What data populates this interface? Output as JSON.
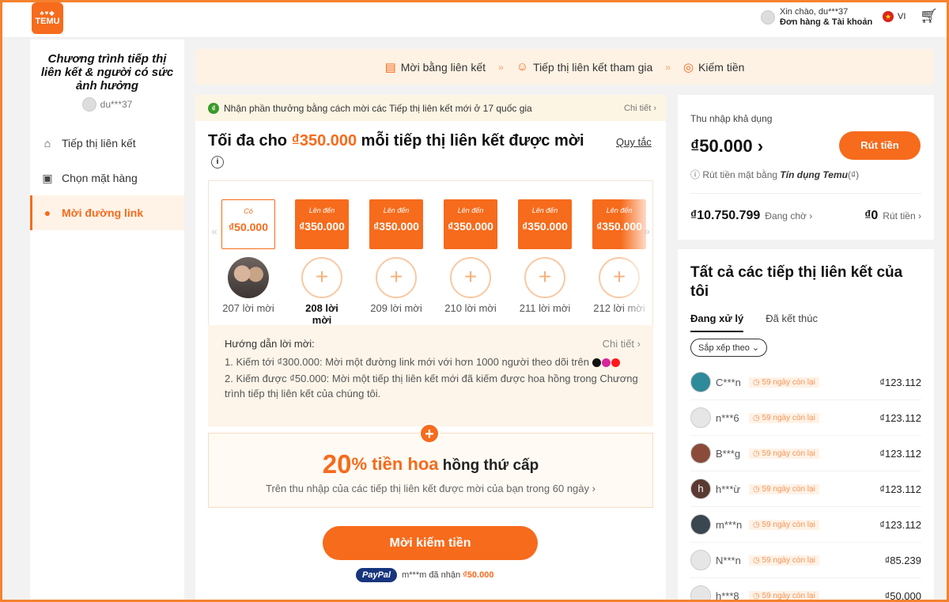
{
  "header": {
    "logo_text": "TEMU",
    "greeting": "Xin chào, du***37",
    "account_label": "Đơn hàng & Tài khoản",
    "language": "VI"
  },
  "sidebar": {
    "title": "Chương trình tiếp thị liên kết & người có sức ảnh hưởng",
    "username": "du***37",
    "items": [
      {
        "label": "Tiếp thị liên kết",
        "icon": "home-icon"
      },
      {
        "label": "Chọn mặt hàng",
        "icon": "bag-icon"
      },
      {
        "label": "Mời đường link",
        "icon": "invite-user-icon",
        "active": true
      }
    ]
  },
  "steps": [
    {
      "label": "Mời bằng liên kết",
      "icon": "document-icon"
    },
    {
      "label": "Tiếp thị liên kết tham gia",
      "icon": "user-join-icon"
    },
    {
      "label": "Kiếm tiền",
      "icon": "money-bag-icon"
    }
  ],
  "main": {
    "banner_text": "Nhận phần thưởng bằng cách mời các Tiếp thị liên kết mới ở 17 quốc gia",
    "banner_more": "Chi tiết",
    "headline_pre": "Tối đa cho ",
    "headline_amount": "₫350.000",
    "headline_post": " mỗi tiếp thị liên kết được mời",
    "rules_link": "Quy tắc",
    "tiers": [
      {
        "cap": "Có",
        "value": "₫50.000",
        "label": "207 lời mời",
        "state": "done"
      },
      {
        "cap": "Lên đến",
        "value": "₫350.000",
        "label": "208 lời mời",
        "state": "current"
      },
      {
        "cap": "Lên đến",
        "value": "₫350.000",
        "label": "209 lời mời",
        "state": "next"
      },
      {
        "cap": "Lên đến",
        "value": "₫350.000",
        "label": "210 lời mời",
        "state": "next"
      },
      {
        "cap": "Lên đến",
        "value": "₫350.000",
        "label": "211 lời mời",
        "state": "next"
      },
      {
        "cap": "Lên đến",
        "value": "₫350.000",
        "label": "212 lời mời",
        "state": "next"
      }
    ],
    "guide": {
      "title": "Hướng dẫn lời mời:",
      "more": "Chi tiết",
      "line1": "1. Kiếm tới ₫300.000: Mời một đường link mới với hơn 1000 người theo dõi trên",
      "line2": "2. Kiếm được ₫50.000: Mời một tiếp thị liên kết mới đã kiếm được hoa hồng trong Chương trình tiếp thị liên kết của chúng tôi."
    },
    "commission": {
      "pct": "20",
      "pct_sign": "% tiền hoa",
      "rest": " hồng thứ cấp",
      "sub": "Trên thu nhập của các tiếp thị liên kết được mời của bạn trong 60 ngày"
    },
    "cta_label": "Mời kiếm tiền",
    "paid": {
      "brand": "PayPal",
      "text": "m***m đã nhận ",
      "amount": "₫50.000"
    }
  },
  "income": {
    "title": "Thu nhập khả dụng",
    "amount": "₫50.000",
    "withdraw_label": "Rút tiền",
    "note_pre": "Rút tiền mặt bằng",
    "note_brand": "Tín dụng Temu",
    "note_suffix": "(₫)",
    "pending_value": "₫10.750.799",
    "pending_label": "Đang chờ",
    "withdrawn_value": "₫0",
    "withdrawn_label": "Rút tiền"
  },
  "affiliates": {
    "title": "Tất cả các tiếp thị liên kết của tôi",
    "tabs": [
      "Đang xử lý",
      "Đã kết thúc"
    ],
    "sort_label": "Sắp xếp theo",
    "rows": [
      {
        "name": "C***n",
        "days": "59 ngày còn lại",
        "amount": "₫123.112",
        "avatar_color": "#2f8a9a"
      },
      {
        "name": "n***6",
        "days": "59 ngày còn lại",
        "amount": "₫123.112",
        "avatar_color": "#e6e6e6"
      },
      {
        "name": "B***g",
        "days": "59 ngày còn lại",
        "amount": "₫123.112",
        "avatar_color": "#8a4b3a"
      },
      {
        "name": "h***ừ",
        "days": "59 ngày còn lại",
        "amount": "₫123.112",
        "avatar_color": "#5a3a32",
        "initial": "h"
      },
      {
        "name": "m***n",
        "days": "59 ngày còn lại",
        "amount": "₫123.112",
        "avatar_color": "#3a4650"
      },
      {
        "name": "N***n",
        "days": "59 ngày còn lại",
        "amount": "₫85.239",
        "avatar_color": "#e6e6e6"
      },
      {
        "name": "h***8",
        "days": "59 ngày còn lại",
        "amount": "₫50.000",
        "avatar_color": "#e6e6e6"
      }
    ]
  },
  "colors": {
    "accent": "#f66b1c",
    "banner_bg": "#fdf5e4",
    "paypal": "#17357e"
  }
}
